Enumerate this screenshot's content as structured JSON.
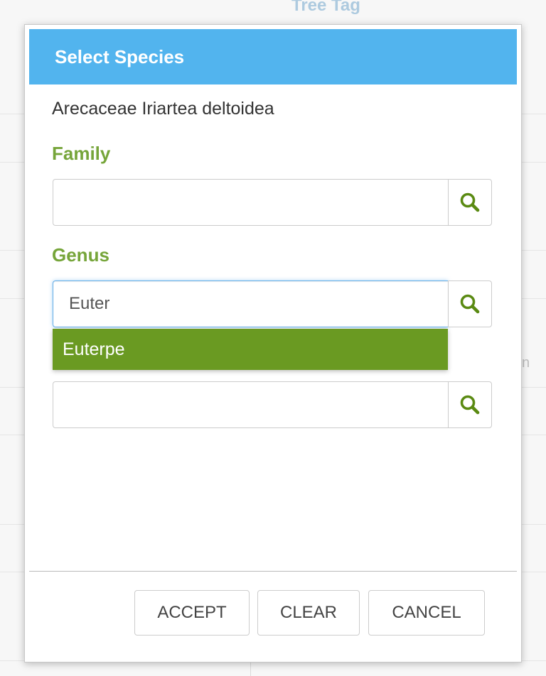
{
  "background": {
    "title": "Tree Tag",
    "fragment": "n"
  },
  "dialog": {
    "title": "Select Species",
    "current_species": "Arecaceae Iriartea deltoidea",
    "family": {
      "label": "Family",
      "value": "",
      "search_icon": "search-icon"
    },
    "genus": {
      "label": "Genus",
      "value": "Euter",
      "search_icon": "search-icon"
    },
    "genus_suggestions": [
      "Euterpe"
    ],
    "species": {
      "label": "",
      "value": "",
      "search_icon": "search-icon"
    },
    "buttons": {
      "accept": "ACCEPT",
      "clear": "CLEAR",
      "cancel": "CANCEL"
    }
  },
  "colors": {
    "header": "#52b4ee",
    "label": "#76a53a",
    "suggestion": "#6a9a22",
    "icon": "#5a8a12"
  }
}
